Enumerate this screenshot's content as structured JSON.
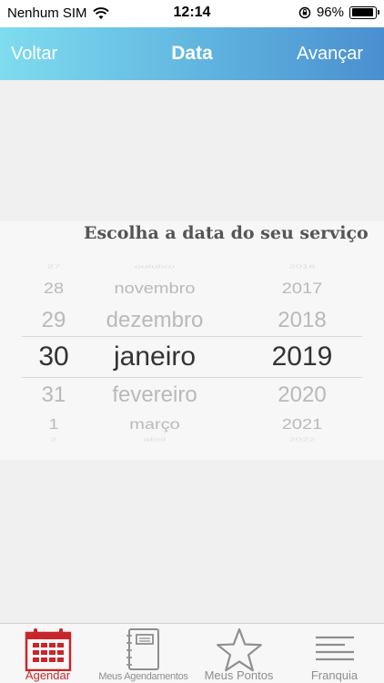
{
  "status_bar": {
    "carrier": "Nenhum SIM",
    "time": "12:14",
    "battery": "96%"
  },
  "nav": {
    "back_label": "Voltar",
    "title": "Data",
    "next_label": "Avançar"
  },
  "picker": {
    "prompt": "Escolha a data do seu serviço",
    "days": [
      "27",
      "28",
      "29",
      "30",
      "31",
      "1",
      "2"
    ],
    "months": [
      "outubro",
      "novembro",
      "dezembro",
      "janeiro",
      "fevereiro",
      "março",
      "abril"
    ],
    "years": [
      "2016",
      "2017",
      "2018",
      "2019",
      "2020",
      "2021",
      "2022"
    ],
    "selected": {
      "day": "30",
      "month": "janeiro",
      "year": "2019"
    }
  },
  "tabs": [
    {
      "label": "Agendar",
      "icon": "calendar-icon",
      "active": true
    },
    {
      "label": "Meus Agendamentos",
      "icon": "notebook-icon",
      "active": false
    },
    {
      "label": "Meus Pontos",
      "icon": "star-icon",
      "active": false
    },
    {
      "label": "Franquia",
      "icon": "menu-lines-icon",
      "active": false
    }
  ],
  "colors": {
    "active_tab": "#c8262b",
    "nav_gradient_start": "#7fdcef",
    "nav_gradient_end": "#4a8fd0"
  }
}
